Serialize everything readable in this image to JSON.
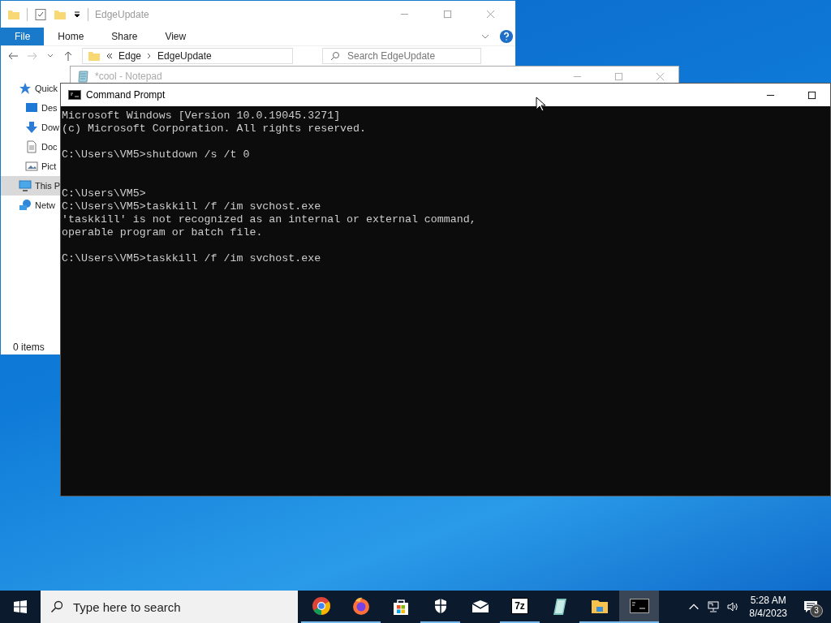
{
  "explorer": {
    "title": "EdgeUpdate",
    "ribbon_tabs": [
      {
        "label": "File",
        "selected": true
      },
      {
        "label": "Home",
        "selected": false
      },
      {
        "label": "Share",
        "selected": false
      },
      {
        "label": "View",
        "selected": false
      }
    ],
    "address": {
      "crumbs": [
        "Edge",
        "EdgeUpdate"
      ]
    },
    "search": {
      "placeholder": "Search EdgeUpdate"
    },
    "nav_items": [
      {
        "label": "Quick",
        "kind": "star",
        "selected": false
      },
      {
        "label": "Des",
        "kind": "desktop",
        "selected": false
      },
      {
        "label": "Dow",
        "kind": "download",
        "selected": false
      },
      {
        "label": "Doc",
        "kind": "document",
        "selected": false
      },
      {
        "label": "Pict",
        "kind": "pictures",
        "selected": false
      },
      {
        "label": "This P",
        "kind": "pc",
        "selected": true
      },
      {
        "label": "Netw",
        "kind": "network",
        "selected": false
      }
    ],
    "status": "0 items"
  },
  "notepad": {
    "title": "*cool - Notepad"
  },
  "cmd": {
    "title": "Command Prompt",
    "lines": [
      {
        "kind": "text",
        "text": "Microsoft Windows [Version 10.0.19045.3271]"
      },
      {
        "kind": "text",
        "text": "(c) Microsoft Corporation. All rights reserved."
      },
      {
        "kind": "blank"
      },
      {
        "kind": "text",
        "text": "C:\\Users\\VM5>shutdown /s /t 0"
      },
      {
        "kind": "blank"
      },
      {
        "kind": "blank"
      },
      {
        "kind": "text",
        "text": "C:\\Users\\VM5>"
      },
      {
        "kind": "text",
        "text": "C:\\Users\\VM5>taskkill /f /im svchost.exe"
      },
      {
        "kind": "text",
        "text": "'taskkill' is not recognized as an internal or external command,"
      },
      {
        "kind": "text",
        "text": "operable program or batch file."
      },
      {
        "kind": "blank"
      },
      {
        "kind": "text",
        "text": "C:\\Users\\VM5>taskkill /f /im svchost.exe"
      }
    ]
  },
  "taskbar": {
    "search": {
      "placeholder": "Type here to search"
    },
    "apps": [
      {
        "kind": "chrome",
        "running": true,
        "selected": false
      },
      {
        "kind": "firefox",
        "running": true,
        "selected": false
      },
      {
        "kind": "store",
        "running": false,
        "selected": false
      },
      {
        "kind": "shield",
        "running": true,
        "selected": false
      },
      {
        "kind": "mail",
        "running": false,
        "selected": false
      },
      {
        "kind": "sevenzip",
        "running": true,
        "selected": false
      },
      {
        "kind": "notepad",
        "running": false,
        "selected": false
      },
      {
        "kind": "explorer",
        "running": true,
        "selected": false
      },
      {
        "kind": "cmd",
        "running": true,
        "selected": true
      }
    ],
    "sevenzip_label": "7z",
    "time": "5:28 AM",
    "date": "8/4/2023",
    "notifications": "3"
  }
}
